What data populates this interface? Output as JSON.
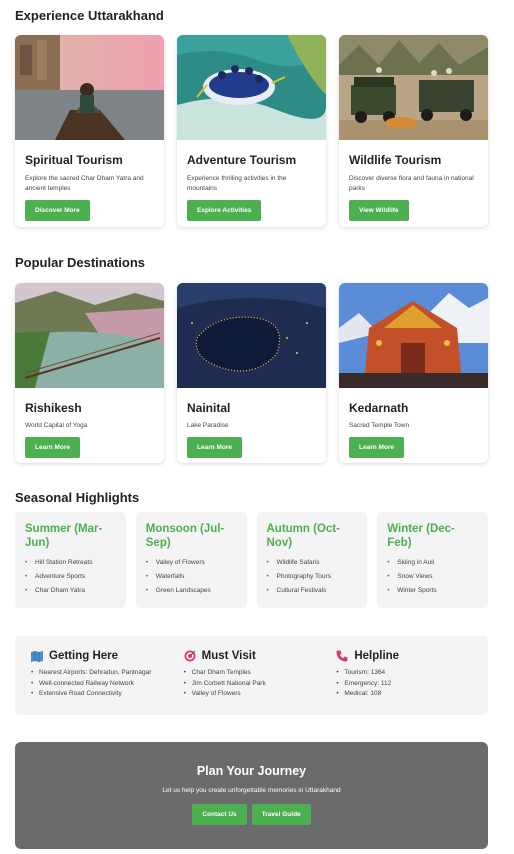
{
  "experience": {
    "title": "Experience Uttarakhand",
    "cards": [
      {
        "title": "Spiritual Tourism",
        "desc": "Explore the sacred Char Dham Yatra and ancient temples",
        "button": "Discover More",
        "image": "river-meditation-photo"
      },
      {
        "title": "Adventure Tourism",
        "desc": "Experience thrilling activities in the mountains",
        "button": "Explore Activities",
        "image": "river-rafting-photo"
      },
      {
        "title": "Wildlife Tourism",
        "desc": "Discover diverse flora and fauna in national parks",
        "button": "View Wildlife",
        "image": "jungle-safari-photo"
      }
    ]
  },
  "destinations": {
    "title": "Popular Destinations",
    "cards": [
      {
        "title": "Rishikesh",
        "desc": "World Capital of Yoga",
        "button": "Learn More",
        "image": "rishikesh-bridge-photo"
      },
      {
        "title": "Nainital",
        "desc": "Lake Paradise",
        "button": "Learn More",
        "image": "nainital-night-lake-photo"
      },
      {
        "title": "Kedarnath",
        "desc": "Sacred Temple Town",
        "button": "Learn More",
        "image": "kedarnath-temple-photo"
      }
    ]
  },
  "seasons": {
    "title": "Seasonal Highlights",
    "items": [
      {
        "title": "Summer (Mar-Jun)",
        "points": [
          "Hill Station Retreats",
          "Adventure Sports",
          "Char Dham Yatra"
        ]
      },
      {
        "title": "Monsoon (Jul-Sep)",
        "points": [
          "Valley of Flowers",
          "Waterfalls",
          "Green Landscapes"
        ]
      },
      {
        "title": "Autumn (Oct-Nov)",
        "points": [
          "Wildlife Safaris",
          "Photography Tours",
          "Cultural Festivals"
        ]
      },
      {
        "title": "Winter (Dec-Feb)",
        "points": [
          "Skiing in Auli",
          "Snow Views",
          "Winter Sports"
        ]
      }
    ]
  },
  "info": [
    {
      "title": "Getting Here",
      "icon": "map-icon",
      "points": [
        "Nearest Airports: Dehradun, Pantnagar",
        "Well-connected Railway Network",
        "Extensive Road Connectivity"
      ]
    },
    {
      "title": "Must Visit",
      "icon": "target-icon",
      "points": [
        "Char Dham Temples",
        "Jim Corbett National Park",
        "Valley of Flowers"
      ]
    },
    {
      "title": "Helpline",
      "icon": "phone-icon",
      "points": [
        "Tourism: 1364",
        "Emergency: 112",
        "Medical: 108"
      ]
    }
  ],
  "cta": {
    "title": "Plan Your Journey",
    "subtitle": "Let us help you create unforgettable memories in Uttarakhand",
    "buttons": [
      "Contact Us",
      "Travel Guide"
    ]
  },
  "colors": {
    "accent": "#4caf50",
    "panel": "#f4f4f4",
    "cta_bg": "#6b6b6b"
  }
}
